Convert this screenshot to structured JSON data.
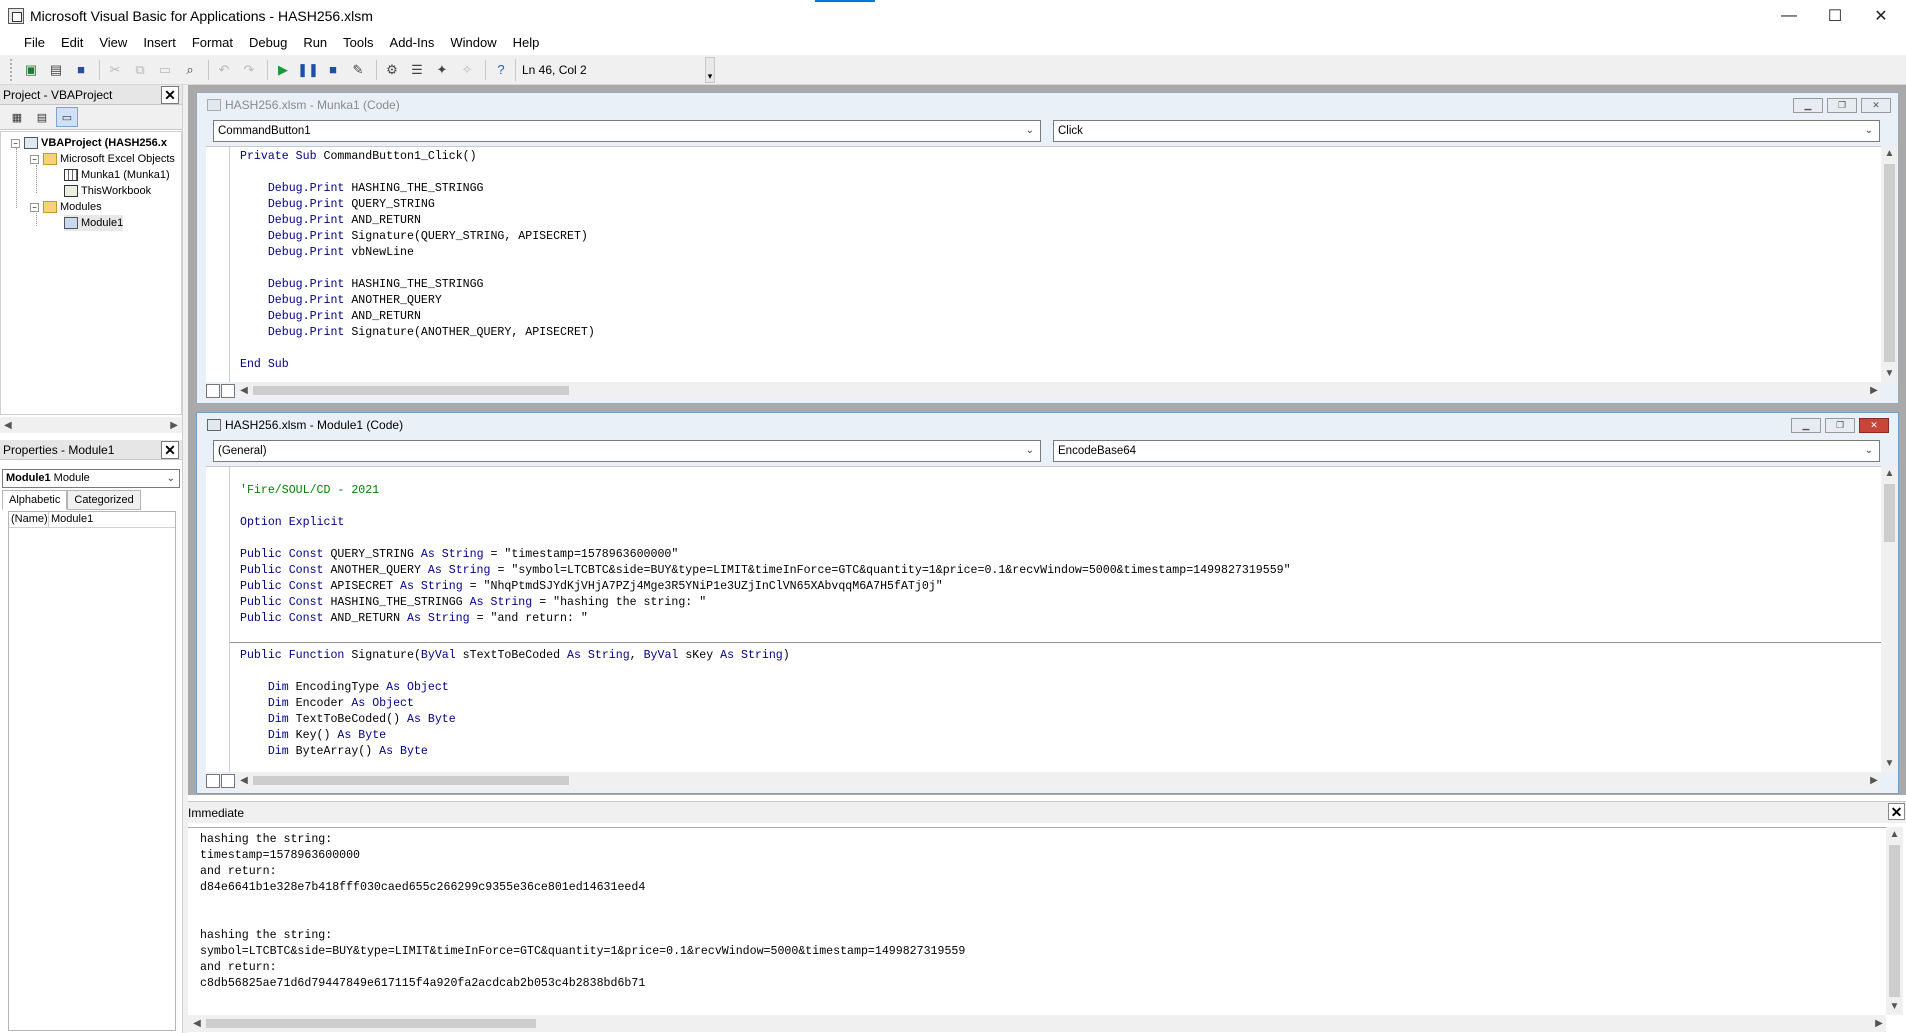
{
  "window": {
    "title": "Microsoft Visual Basic for Applications - HASH256.xlsm",
    "minimize": "—",
    "maximize": "☐",
    "close": "✕"
  },
  "menu": [
    "File",
    "Edit",
    "View",
    "Insert",
    "Format",
    "Debug",
    "Run",
    "Tools",
    "Add-Ins",
    "Window",
    "Help"
  ],
  "toolbar": {
    "position": "Ln 46, Col 2"
  },
  "project_panel": {
    "title": "Project - VBAProject",
    "close": "✕",
    "tree": {
      "root": "VBAProject (HASH256.x",
      "excel_objects": "Microsoft Excel Objects",
      "sheet": "Munka1 (Munka1)",
      "workbook": "ThisWorkbook",
      "modules": "Modules",
      "module": "Module1"
    }
  },
  "properties_panel": {
    "title": "Properties - Module1",
    "close": "✕",
    "combo_bold": "Module1",
    "combo_rest": " Module",
    "tab_alphabetic": "Alphabetic",
    "tab_categorized": "Categorized",
    "row_key": "(Name)",
    "row_value": "Module1"
  },
  "code_window_1": {
    "title": "HASH256.xlsm - Munka1 (Code)",
    "object_combo": "CommandButton1",
    "proc_combo": "Click",
    "lines": [
      [
        {
          "t": "Private Sub ",
          "c": "kw"
        },
        {
          "t": "CommandButton1_Click()"
        }
      ],
      [],
      [
        {
          "t": "    Debug.Print ",
          "c": "kw"
        },
        {
          "t": "HASHING_THE_STRINGG"
        }
      ],
      [
        {
          "t": "    Debug.Print ",
          "c": "kw"
        },
        {
          "t": "QUERY_STRING"
        }
      ],
      [
        {
          "t": "    Debug.Print ",
          "c": "kw"
        },
        {
          "t": "AND_RETURN"
        }
      ],
      [
        {
          "t": "    Debug.Print ",
          "c": "kw"
        },
        {
          "t": "Signature(QUERY_STRING, APISECRET)"
        }
      ],
      [
        {
          "t": "    Debug.Print ",
          "c": "kw"
        },
        {
          "t": "vbNewLine"
        }
      ],
      [],
      [
        {
          "t": "    Debug.Print ",
          "c": "kw"
        },
        {
          "t": "HASHING_THE_STRINGG"
        }
      ],
      [
        {
          "t": "    Debug.Print ",
          "c": "kw"
        },
        {
          "t": "ANOTHER_QUERY"
        }
      ],
      [
        {
          "t": "    Debug.Print ",
          "c": "kw"
        },
        {
          "t": "AND_RETURN"
        }
      ],
      [
        {
          "t": "    Debug.Print ",
          "c": "kw"
        },
        {
          "t": "Signature(ANOTHER_QUERY, APISECRET)"
        }
      ],
      [],
      [
        {
          "t": "End Sub",
          "c": "kw"
        }
      ]
    ]
  },
  "code_window_2": {
    "title": "HASH256.xlsm - Module1 (Code)",
    "object_combo": "(General)",
    "proc_combo": "EncodeBase64",
    "lines_top": [
      [],
      [
        {
          "t": "'Fire/SOUL/CD - 2021",
          "c": "cm"
        }
      ],
      [],
      [
        {
          "t": "Option Explicit",
          "c": "kw"
        }
      ],
      [],
      [
        {
          "t": "Public Const ",
          "c": "kw"
        },
        {
          "t": "QUERY_STRING "
        },
        {
          "t": "As String",
          "c": "kw"
        },
        {
          "t": " = \"timestamp=1578963600000\""
        }
      ],
      [
        {
          "t": "Public Const ",
          "c": "kw"
        },
        {
          "t": "ANOTHER_QUERY "
        },
        {
          "t": "As String",
          "c": "kw"
        },
        {
          "t": " = \"symbol=LTCBTC&side=BUY&type=LIMIT&timeInForce=GTC&quantity=1&price=0.1&recvWindow=5000&timestamp=1499827319559\""
        }
      ],
      [
        {
          "t": "Public Const ",
          "c": "kw"
        },
        {
          "t": "APISECRET "
        },
        {
          "t": "As String",
          "c": "kw"
        },
        {
          "t": " = \"NhqPtmdSJYdKjVHjA7PZj4Mge3R5YNiP1e3UZjInClVN65XAbvqqM6A7H5fATj0j\""
        }
      ],
      [
        {
          "t": "Public Const ",
          "c": "kw"
        },
        {
          "t": "HASHING_THE_STRINGG "
        },
        {
          "t": "As String",
          "c": "kw"
        },
        {
          "t": " = \"hashing the string: \""
        }
      ],
      [
        {
          "t": "Public Const ",
          "c": "kw"
        },
        {
          "t": "AND_RETURN "
        },
        {
          "t": "As String",
          "c": "kw"
        },
        {
          "t": " = \"and return: \""
        }
      ]
    ],
    "lines_bottom": [
      [
        {
          "t": "Public Function ",
          "c": "kw"
        },
        {
          "t": "Signature("
        },
        {
          "t": "ByVal ",
          "c": "kw"
        },
        {
          "t": "sTextToBeCoded "
        },
        {
          "t": "As String",
          "c": "kw"
        },
        {
          "t": ", "
        },
        {
          "t": "ByVal ",
          "c": "kw"
        },
        {
          "t": "sKey "
        },
        {
          "t": "As String",
          "c": "kw"
        },
        {
          "t": ")"
        }
      ],
      [],
      [
        {
          "t": "    Dim ",
          "c": "kw"
        },
        {
          "t": "EncodingType "
        },
        {
          "t": "As Object",
          "c": "kw"
        }
      ],
      [
        {
          "t": "    Dim ",
          "c": "kw"
        },
        {
          "t": "Encoder "
        },
        {
          "t": "As Object",
          "c": "kw"
        }
      ],
      [
        {
          "t": "    Dim ",
          "c": "kw"
        },
        {
          "t": "TextToBeCoded() "
        },
        {
          "t": "As Byte",
          "c": "kw"
        }
      ],
      [
        {
          "t": "    Dim ",
          "c": "kw"
        },
        {
          "t": "Key() "
        },
        {
          "t": "As Byte",
          "c": "kw"
        }
      ],
      [
        {
          "t": "    Dim ",
          "c": "kw"
        },
        {
          "t": "ByteArray() "
        },
        {
          "t": "As Byte",
          "c": "kw"
        }
      ]
    ]
  },
  "immediate": {
    "title": "Immediate",
    "close": "✕",
    "lines": [
      "hashing the string:",
      "timestamp=1578963600000",
      "and return:",
      "d84e6641b1e328e7b418fff030caed655c266299c9355e36ce801ed14631eed4",
      "",
      "",
      "hashing the string:",
      "symbol=LTCBTC&side=BUY&type=LIMIT&timeInForce=GTC&quantity=1&price=0.1&recvWindow=5000&timestamp=1499827319559",
      "and return:",
      "c8db56825ae71d6d79447849e617115f4a920fa2acdcab2b053c4b2838bd6b71"
    ]
  }
}
